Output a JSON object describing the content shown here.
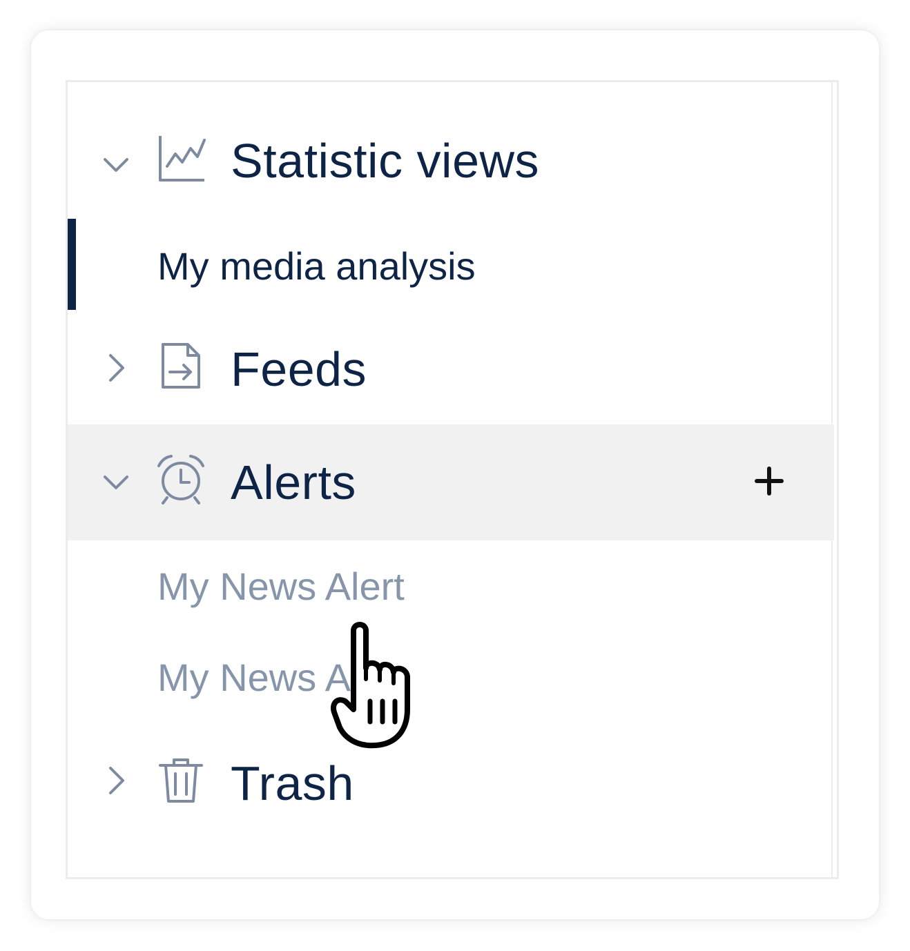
{
  "nav": {
    "sections": {
      "statistic_views": {
        "label": "Statistic views",
        "icon": "line-chart-icon",
        "expanded": true,
        "items": [
          {
            "label": "My media analysis",
            "active": true
          }
        ]
      },
      "feeds": {
        "label": "Feeds",
        "icon": "file-import-icon",
        "expanded": false
      },
      "alerts": {
        "label": "Alerts",
        "icon": "alarm-clock-icon",
        "expanded": true,
        "add_icon": "plus-icon",
        "items": [
          {
            "label": "My News Alert"
          },
          {
            "label": "My News Alert"
          }
        ]
      },
      "trash": {
        "label": "Trash",
        "icon": "trash-icon",
        "expanded": false
      }
    }
  },
  "colors": {
    "text_primary": "#0e2447",
    "text_muted": "#8795ab",
    "icon": "#7d8aa0",
    "hover_bg": "#f1f1f2",
    "active_indicator": "#0e2447"
  },
  "cursor": "hand-pointer-icon"
}
